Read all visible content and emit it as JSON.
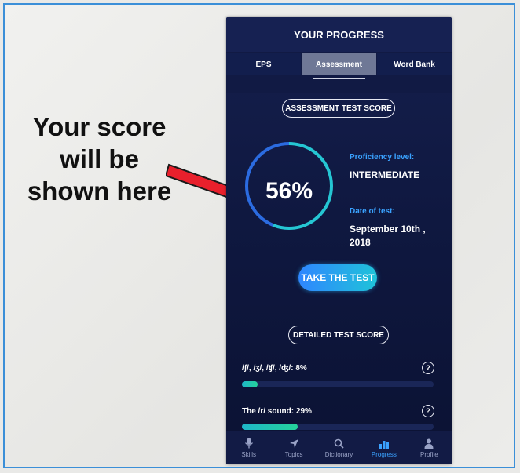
{
  "callout": {
    "line1": "Your score",
    "line2": "will be",
    "line3": "shown here"
  },
  "app": {
    "title": "YOUR PROGRESS",
    "tabs": [
      {
        "label": "EPS",
        "active": false
      },
      {
        "label": "Assessment",
        "active": true
      },
      {
        "label": "Word Bank",
        "active": false
      }
    ],
    "assessment_pill": "ASSESSMENT TEST SCORE",
    "score_text": "56%",
    "score_value": 0.56,
    "proficiency_label": "Proficiency level:",
    "proficiency_value": "INTERMEDIATE",
    "date_label": "Date of test:",
    "date_value_line1": "September 10th ,",
    "date_value_line2": "2018",
    "take_test": "TAKE THE TEST",
    "detailed_pill": "DETAILED TEST SCORE",
    "skills": [
      {
        "label": "/ʃ/, /ʒ/, /ʧ/, /ʤ/: 8%",
        "progress": 0.08
      },
      {
        "label": "The /r/ sound: 29%",
        "progress": 0.29
      }
    ],
    "help_glyph": "?",
    "nav": [
      {
        "label": "Skills",
        "icon": "mic-icon",
        "active": false
      },
      {
        "label": "Topics",
        "icon": "navigation-arrow-icon",
        "active": false
      },
      {
        "label": "Dictionary",
        "icon": "search-icon",
        "active": false
      },
      {
        "label": "Progress",
        "icon": "bar-chart-icon",
        "active": true
      },
      {
        "label": "Profile",
        "icon": "person-icon",
        "active": false
      }
    ]
  },
  "colors": {
    "accent": "#3aa2ff",
    "arrow": "#e8202c",
    "gauge_fill": "#25c6d3",
    "gauge_track": "#2b6be0"
  }
}
